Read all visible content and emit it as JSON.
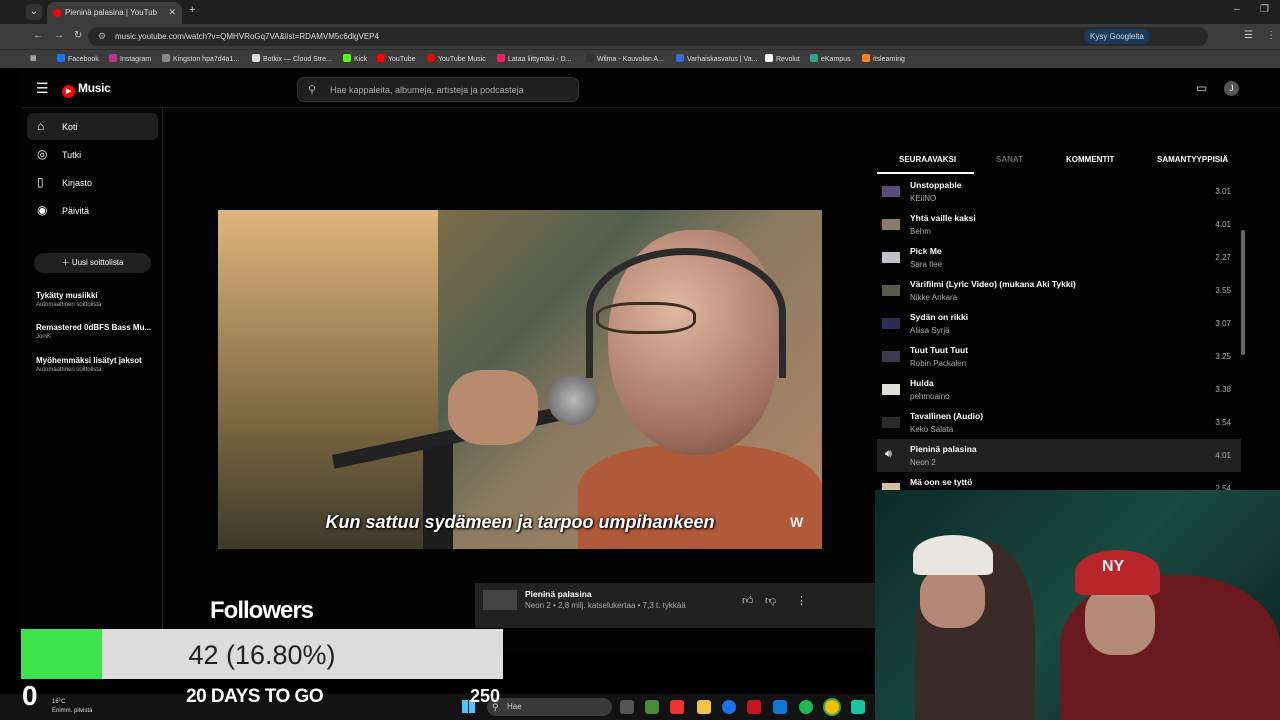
{
  "browser": {
    "tab_title": "Pieninä palasina | YouTube",
    "url": "music.youtube.com/watch?v=QMHVRoGq7VA&list=RDAMVM5c6dlgVEP4",
    "ask_google": "Kysy Googlelta",
    "bookmarks": [
      "Facebook",
      "Instagram",
      "Kingston hpa7d4a1...",
      "Botkix — Cloud Stre...",
      "Kick",
      "YouTube",
      "YouTube Music",
      "Lataa liittymäsi - D...",
      "Wilma - Kouvolan A...",
      "Varhaiskasvatus | Va...",
      "Revolut",
      "eKampus",
      "itslearning"
    ]
  },
  "ytm": {
    "logo": "Music",
    "search_placeholder": "Hae kappaleita, albumeja, artisteja ja podcasteja",
    "account_initial": "J",
    "nav": [
      {
        "label": "Koti",
        "icon": "home-icon"
      },
      {
        "label": "Tutki",
        "icon": "compass-icon"
      },
      {
        "label": "Kirjasto",
        "icon": "library-icon"
      },
      {
        "label": "Päivitä",
        "icon": "upgrade-icon"
      }
    ],
    "new_playlist": "Uusi soittolista",
    "playlists": [
      {
        "name": "Tykätty musiikki",
        "sub": "Automaattinen soittolista"
      },
      {
        "name": "Remastered 0dBFS Bass Mu...",
        "sub": "JoniK"
      },
      {
        "name": "Myöhemmäksi lisätyt jaksot",
        "sub": "Automaattinen soittolista"
      }
    ],
    "subtitle": "Kun sattuu sydämeen ja tarpoo umpihankeen",
    "watermark": "W",
    "up_tabs": [
      "SEURAAVAKSI",
      "SANAT",
      "KOMMENTIT",
      "SAMANTYYPPISIÄ"
    ],
    "queue": [
      {
        "title": "Unstoppable",
        "artist": "KEiiNO",
        "duration": "3.01"
      },
      {
        "title": "Yhtä vaille kaksi",
        "artist": "Behm",
        "duration": "4.01"
      },
      {
        "title": "Pick Me",
        "artist": "Sara Ilee",
        "duration": "2.27"
      },
      {
        "title": "Värifilmi (Lyric Video) (mukana Aki Tykki)",
        "artist": "Nikke Ankara",
        "duration": "3.55"
      },
      {
        "title": "Sydän on rikki",
        "artist": "Aliisa Syrjä",
        "duration": "3.07"
      },
      {
        "title": "Tuut Tuut Tuut",
        "artist": "Robin Packalen",
        "duration": "3.25"
      },
      {
        "title": "Hulda",
        "artist": "pehmoaino",
        "duration": "3.38"
      },
      {
        "title": "Tavallinen (Audio)",
        "artist": "Keko Salata",
        "duration": "3.54"
      },
      {
        "title": "Pieninä palasina",
        "artist": "Neon 2",
        "duration": "4.01"
      },
      {
        "title": "Mä oon se tyttö",
        "artist": "",
        "duration": "2.54"
      }
    ],
    "current_index": 8,
    "player": {
      "title": "Pieninä palasina",
      "sub": "Neon 2 • 2,8 milj. katselukertaa • 7,3 t. tykkää"
    }
  },
  "overlay": {
    "heading": "Followers",
    "progress_text": "42 (16.80%)",
    "progress_fraction": 0.168,
    "min": "0",
    "max": "250",
    "days": "20 DAYS TO GO"
  },
  "taskbar": {
    "temp": "16°C",
    "weather": "Enimm. pilvistä",
    "search": "Hae"
  },
  "colors": {
    "accent": "#ff0000",
    "progress": "#3de24c"
  }
}
